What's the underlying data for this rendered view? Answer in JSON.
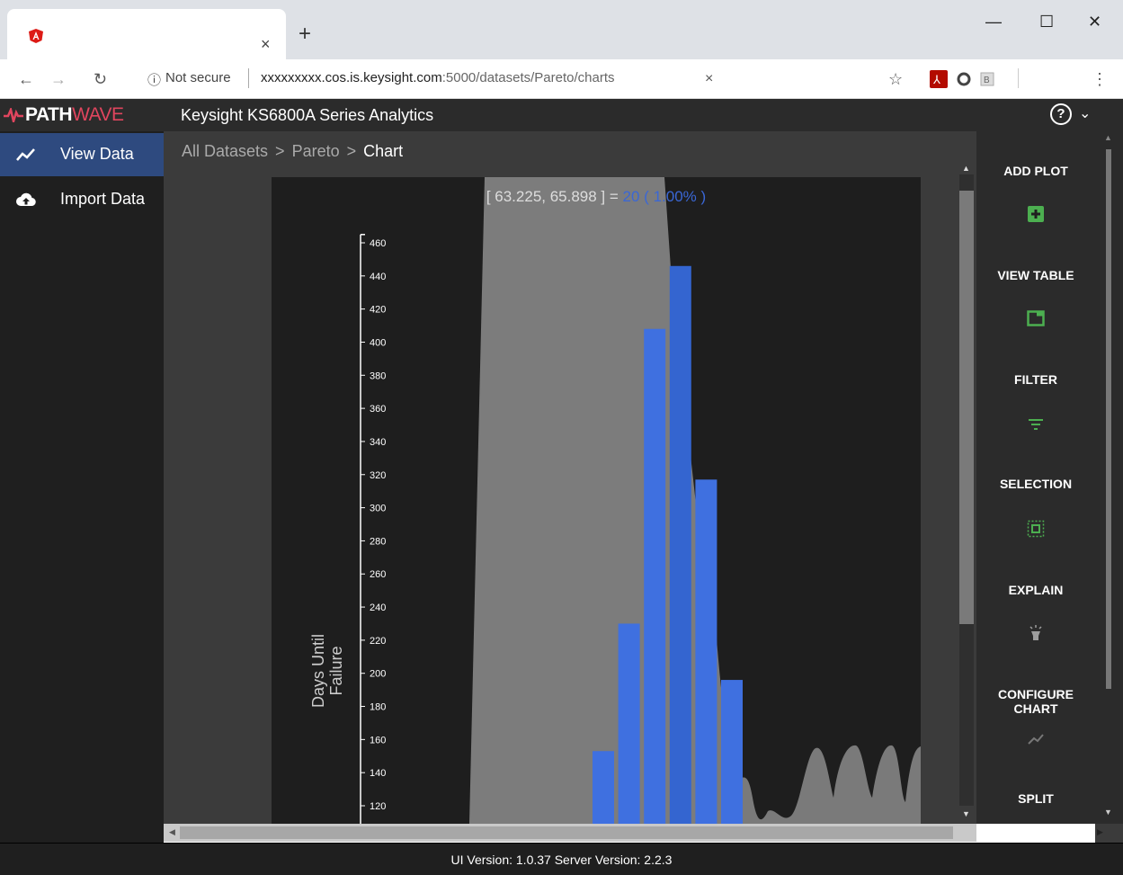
{
  "browser": {
    "tab_close": "×",
    "new_tab": "+",
    "minimize": "—",
    "maximize": "☐",
    "close": "✕",
    "info_icon": "ⓘ",
    "not_secure": "Not secure",
    "url_host": "xxxxxxxxx.cos.is.keysight.com",
    "url_path": ":5000/datasets/Pareto/charts",
    "url_clear": "×"
  },
  "header": {
    "logo_path": "PATH",
    "logo_wave": "WAVE",
    "title": "Keysight KS6800A Series Analytics",
    "help": "?",
    "chevron": "⌄"
  },
  "sidebar": {
    "items": [
      {
        "label": "View Data"
      },
      {
        "label": "Import Data"
      }
    ]
  },
  "breadcrumb": {
    "root": "All Datasets",
    "sep": ">",
    "dataset": "Pareto",
    "current": "Chart"
  },
  "chart": {
    "tooltip_range": "[ 63.225, 65.898 ] = ",
    "tooltip_value": "20 ( 1.00% )",
    "ylabel_line1": "Days Until",
    "ylabel_line2": "Failure"
  },
  "chart_data": {
    "type": "bar",
    "ylabel": "Days Until Failure",
    "ylim": [
      110,
      465
    ],
    "yticks": [
      120,
      140,
      160,
      180,
      200,
      220,
      240,
      260,
      280,
      300,
      320,
      340,
      360,
      380,
      400,
      420,
      440,
      460
    ],
    "values": [
      153,
      230,
      408,
      446,
      317,
      196
    ],
    "highlight_index": 3,
    "colors": {
      "bar": "#3f70e0",
      "bar_highlight": "#3465d0",
      "density": "#7a7a7a",
      "selection": "#7c7c7c"
    }
  },
  "tools": [
    {
      "label": "ADD PLOT",
      "icon": "add-plot-icon"
    },
    {
      "label": "VIEW TABLE",
      "icon": "view-table-icon"
    },
    {
      "label": "FILTER",
      "icon": "filter-icon"
    },
    {
      "label": "SELECTION",
      "icon": "selection-icon"
    },
    {
      "label": "EXPLAIN",
      "icon": "explain-icon"
    },
    {
      "label": "CONFIGURE CHART",
      "icon": "configure-chart-icon"
    },
    {
      "label": "SPLIT",
      "icon": "split-icon"
    }
  ],
  "footer": {
    "text": "UI Version: 1.0.37 Server Version: 2.2.3"
  },
  "colors": {
    "accent_green": "#4caf50",
    "sidebar_active": "#2e4a7f",
    "logo_wave": "#e0455e"
  }
}
